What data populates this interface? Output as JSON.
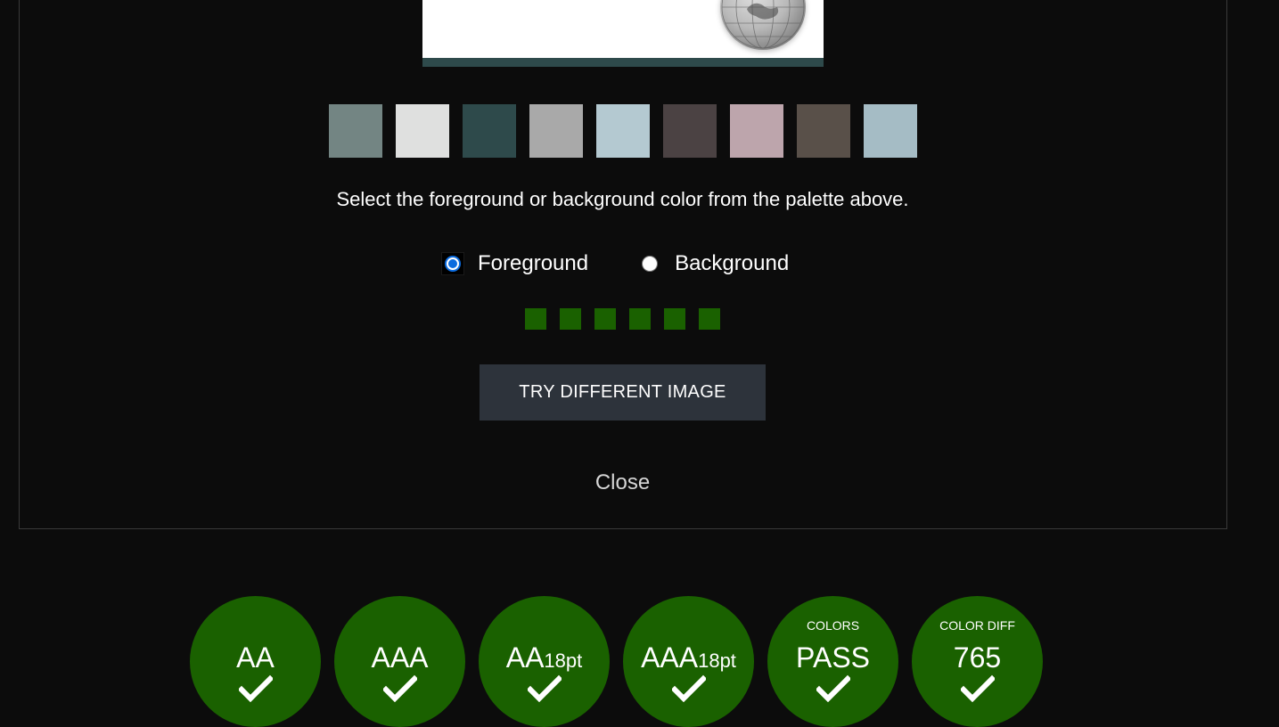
{
  "palette": {
    "instruction": "Select the foreground or background color from the palette above.",
    "swatches": [
      "#738583",
      "#dfe0df",
      "#2e4a4b",
      "#a9a9a9",
      "#b4c9d1",
      "#4b4243",
      "#bda5ac",
      "#595049",
      "#a5bcc5"
    ]
  },
  "mode": {
    "foreground_label": "Foreground",
    "background_label": "Background",
    "selected": "Foreground"
  },
  "indicator_count": 6,
  "buttons": {
    "try_different_image": "TRY DIFFERENT IMAGE",
    "close": "Close"
  },
  "colors": {
    "pass": "#1a6100",
    "button_bg": "#2d333b",
    "accent": "#0b6bde"
  },
  "results": [
    {
      "top": "",
      "main": "AA",
      "sub": "",
      "status": "pass"
    },
    {
      "top": "",
      "main": "AAA",
      "sub": "",
      "status": "pass"
    },
    {
      "top": "",
      "main": "AA",
      "sub": "18pt",
      "status": "pass"
    },
    {
      "top": "",
      "main": "AAA",
      "sub": "18pt",
      "status": "pass"
    },
    {
      "top": "COLORS",
      "main": "PASS",
      "sub": "",
      "status": "pass"
    },
    {
      "top": "COLOR DIFF",
      "main": "765",
      "sub": "",
      "status": "pass"
    }
  ]
}
